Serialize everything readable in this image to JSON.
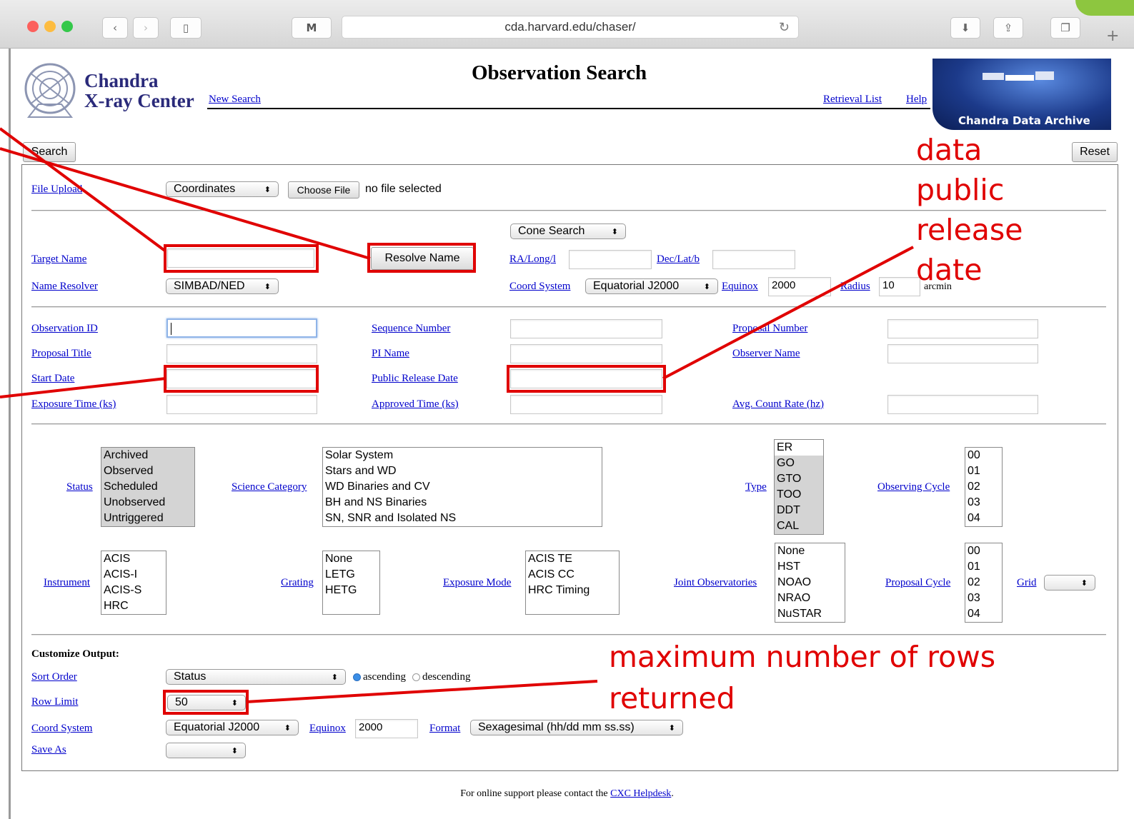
{
  "browser": {
    "url": "cda.harvard.edu/chaser/",
    "m_label": "M"
  },
  "header": {
    "logo_line1": "Chandra",
    "logo_line2": "X-ray Center",
    "title": "Observation Search",
    "new_search": "New Search",
    "retrieval_list": "Retrieval List",
    "help": "Help",
    "archive_banner": "Chandra Data Archive"
  },
  "toolbar": {
    "search": "Search",
    "reset": "Reset"
  },
  "upload": {
    "label": "File Upload",
    "type": "Coordinates",
    "choose": "Choose File",
    "file_status": "no file selected"
  },
  "target": {
    "target_name": "Target Name",
    "resolve": "Resolve Name",
    "name_resolver": "Name Resolver",
    "resolver_value": "SIMBAD/NED",
    "cone": "Cone Search",
    "ra": "RA/Long/l",
    "dec": "Dec/Lat/b",
    "coord_system": "Coord System",
    "coord_value": "Equatorial J2000",
    "equinox": "Equinox",
    "equinox_value": "2000",
    "radius": "Radius",
    "radius_value": "10",
    "radius_unit": "arcmin"
  },
  "fields": {
    "obsid": "Observation ID",
    "seq": "Sequence Number",
    "prop_num": "Proposal Number",
    "prop_title": "Proposal Title",
    "pi": "PI Name",
    "observer": "Observer Name",
    "start": "Start Date",
    "public": "Public Release Date",
    "exposure": "Exposure Time (ks)",
    "approved": "Approved Time (ks)",
    "count_rate": "Avg. Count Rate (hz)"
  },
  "filters": {
    "status": "Status",
    "status_items": [
      "Archived",
      "Observed",
      "Scheduled",
      "Unobserved",
      "Untriggered"
    ],
    "science": "Science Category",
    "science_items": [
      "Solar System",
      "Stars and WD",
      "WD Binaries and CV",
      "BH and NS Binaries",
      "SN, SNR and Isolated NS"
    ],
    "type": "Type",
    "type_items": [
      "ER",
      "GO",
      "GTO",
      "TOO",
      "DDT",
      "CAL"
    ],
    "obs_cycle": "Observing Cycle",
    "obs_cycle_items": [
      "00",
      "01",
      "02",
      "03",
      "04"
    ],
    "instrument": "Instrument",
    "instrument_items": [
      "ACIS",
      "ACIS-I",
      "ACIS-S",
      "HRC"
    ],
    "grating": "Grating",
    "grating_items": [
      "None",
      "LETG",
      "HETG"
    ],
    "exp_mode": "Exposure Mode",
    "exp_mode_items": [
      "ACIS TE",
      "ACIS CC",
      "HRC Timing"
    ],
    "joint": "Joint Observatories",
    "joint_items": [
      "None",
      "HST",
      "NOAO",
      "NRAO",
      "NuSTAR"
    ],
    "prop_cycle": "Proposal Cycle",
    "prop_cycle_items": [
      "00",
      "01",
      "02",
      "03",
      "04"
    ],
    "grid": "Grid"
  },
  "output": {
    "heading": "Customize Output:",
    "sort": "Sort Order",
    "sort_value": "Status",
    "asc": "ascending",
    "desc": "descending",
    "row_limit": "Row Limit",
    "row_value": "50",
    "coord": "Coord System",
    "coord_value": "Equatorial J2000",
    "equinox": "Equinox",
    "equinox_value": "2000",
    "format": "Format",
    "format_value": "Sexagesimal (hh/dd mm ss.ss)",
    "save_as": "Save As"
  },
  "footer": {
    "text": "For online support please contact the",
    "link": "CXC Helpdesk",
    "end": "."
  },
  "annotations": {
    "release": [
      "data",
      "public",
      "release",
      "date"
    ],
    "rows1": "maximum number of rows",
    "rows2": "returned"
  },
  "colors": {
    "link": "#0000cc",
    "annotation": "#e00000"
  }
}
